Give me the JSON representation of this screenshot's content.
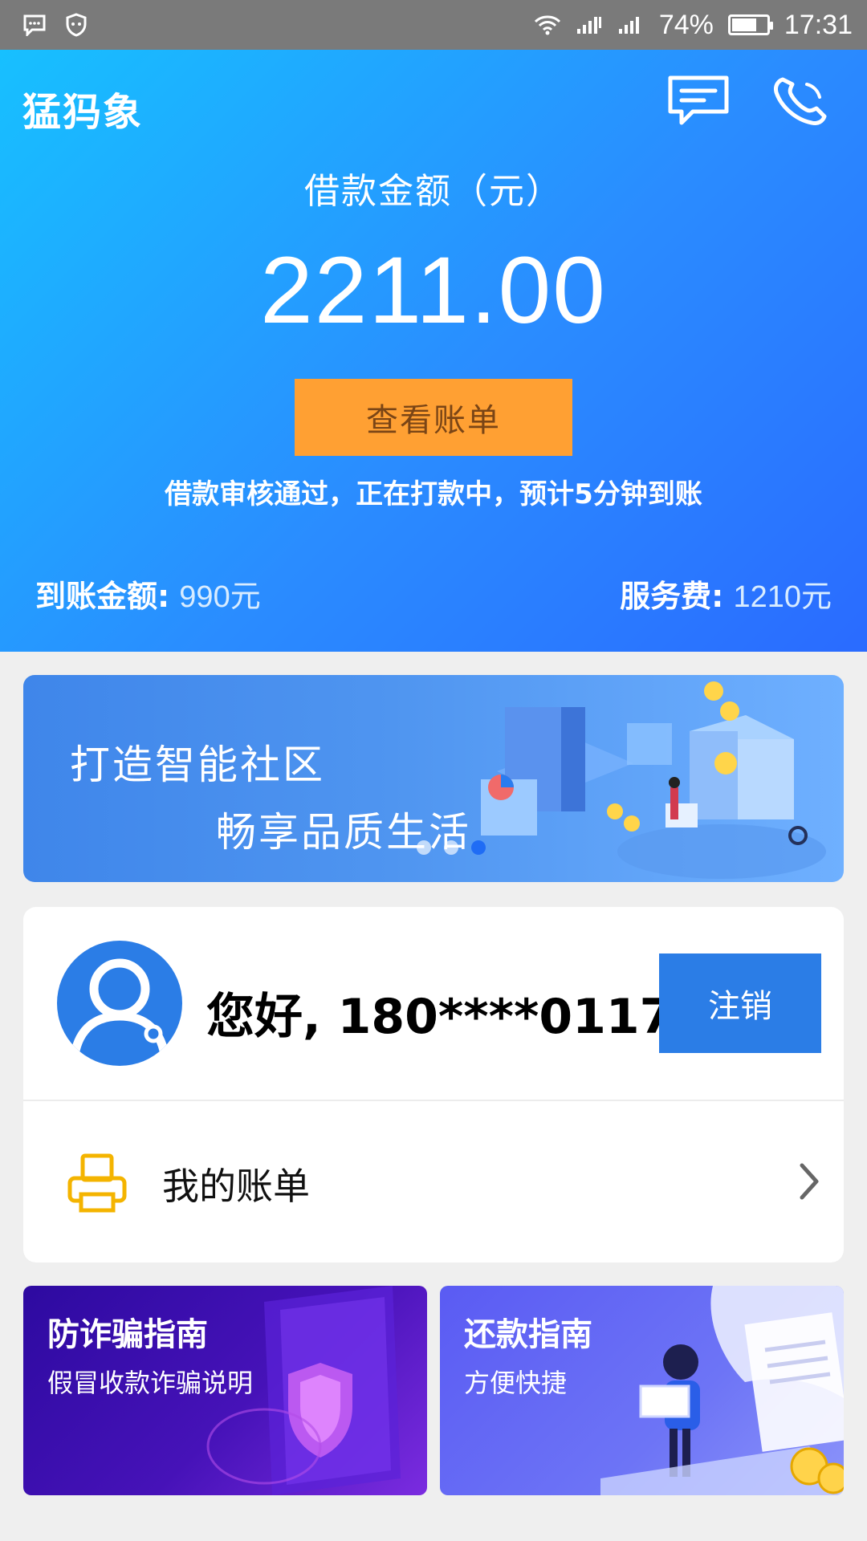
{
  "status_bar": {
    "battery_percent": "74%",
    "time": "17:31",
    "battery_level": 0.74,
    "icons": [
      "message-notification-icon",
      "shield-icon",
      "wifi-icon",
      "signal-icon",
      "signal-icon",
      "battery-icon"
    ]
  },
  "header": {
    "brand": "猛犸象",
    "icons": [
      "chat-icon",
      "phone-icon"
    ]
  },
  "loan": {
    "label": "借款金额（元）",
    "amount": "2211.00",
    "view_bill_button": "查看账单",
    "notice": "借款审核通过，正在打款中，预计5分钟到账",
    "received_label": "到账金额:",
    "received_value": "990元",
    "fee_label": "服务费:",
    "fee_value": "1210元"
  },
  "banner": {
    "line1": "打造智能社区",
    "line2": "畅享品质生活",
    "slide_count": 3,
    "active_slide": 3
  },
  "user": {
    "greeting": "您好, 180****0117",
    "logout_button": "注销",
    "my_bills": "我的账单"
  },
  "guides": [
    {
      "title": "防诈骗指南",
      "subtitle": "假冒收款诈骗说明"
    },
    {
      "title": "还款指南",
      "subtitle": "方便快捷"
    }
  ],
  "colors": {
    "accent_blue": "#2b7de6",
    "orange_button": "#ffa033",
    "fraud_card": "#3a10b0",
    "repay_card": "#5f63f5"
  }
}
